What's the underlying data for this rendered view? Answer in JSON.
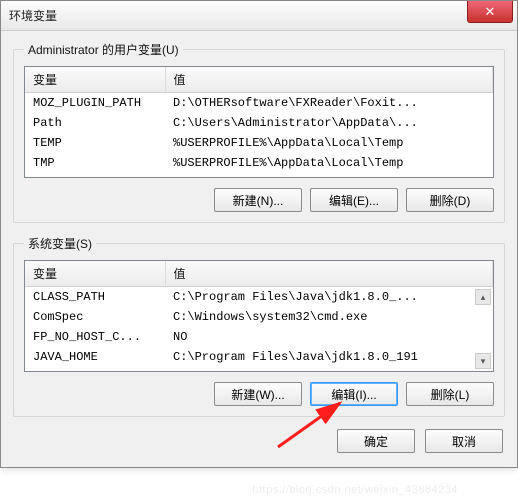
{
  "title": "环境变量",
  "close_glyph": "✕",
  "user_group": {
    "legend": "Administrator 的用户变量(U)",
    "head_var": "变量",
    "head_val": "值",
    "rows": [
      {
        "var": "MOZ_PLUGIN_PATH",
        "val": "D:\\OTHERsoftware\\FXReader\\Foxit..."
      },
      {
        "var": "Path",
        "val": "C:\\Users\\Administrator\\AppData\\..."
      },
      {
        "var": "TEMP",
        "val": "%USERPROFILE%\\AppData\\Local\\Temp"
      },
      {
        "var": "TMP",
        "val": "%USERPROFILE%\\AppData\\Local\\Temp"
      }
    ],
    "btn_new": "新建(N)...",
    "btn_edit": "编辑(E)...",
    "btn_del": "删除(D)"
  },
  "sys_group": {
    "legend": "系统变量(S)",
    "head_var": "变量",
    "head_val": "值",
    "rows": [
      {
        "var": "CLASS_PATH",
        "val": "C:\\Program Files\\Java\\jdk1.8.0_..."
      },
      {
        "var": "ComSpec",
        "val": "C:\\Windows\\system32\\cmd.exe"
      },
      {
        "var": "FP_NO_HOST_C...",
        "val": "NO"
      },
      {
        "var": "JAVA_HOME",
        "val": "C:\\Program Files\\Java\\jdk1.8.0_191"
      }
    ],
    "btn_new": "新建(W)...",
    "btn_edit": "编辑(I)...",
    "btn_del": "删除(L)"
  },
  "dialog": {
    "ok": "确定",
    "cancel": "取消"
  },
  "watermark": "https://blog.csdn.net/weixin_43884234"
}
